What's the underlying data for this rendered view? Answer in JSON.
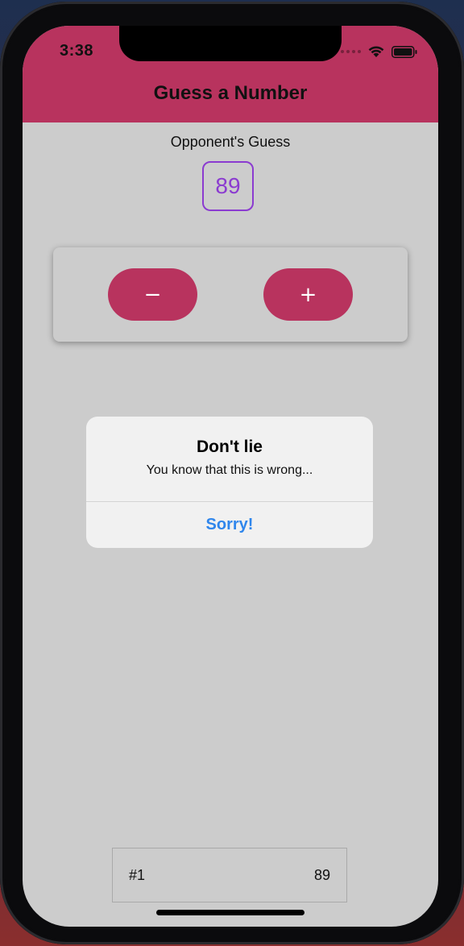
{
  "status_bar": {
    "time": "3:38"
  },
  "header": {
    "title": "Guess a Number",
    "color": "#b8335e"
  },
  "guess": {
    "label": "Opponent's Guess",
    "value": "89",
    "accent_color": "#8b3bd0"
  },
  "controls": {
    "lower_label": "−",
    "higher_label": "+"
  },
  "alert": {
    "title": "Don't lie",
    "message": "You know that this is wrong...",
    "action_label": "Sorry!",
    "action_color": "#2f86ec"
  },
  "log": {
    "items": [
      {
        "round": "#1",
        "value": "89"
      }
    ]
  }
}
